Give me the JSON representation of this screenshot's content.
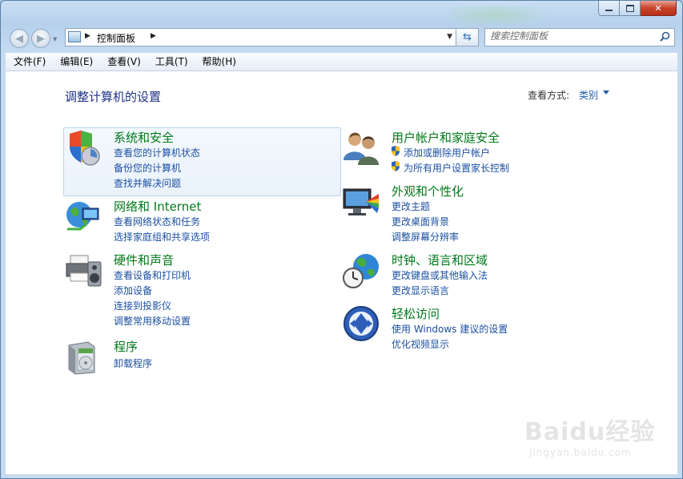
{
  "window": {
    "address": {
      "crumb": "控制面板"
    },
    "search": {
      "placeholder": "搜索控制面板"
    }
  },
  "menu": [
    "文件(F)",
    "编辑(E)",
    "查看(V)",
    "工具(T)",
    "帮助(H)"
  ],
  "page": {
    "title": "调整计算机的设置",
    "view_by_label": "查看方式:",
    "view_by_value": "类别"
  },
  "categories": [
    {
      "title": "系统和安全",
      "links": [
        "查看您的计算机状态",
        "备份您的计算机",
        "查找并解决问题"
      ]
    },
    {
      "title": "网络和 Internet",
      "links": [
        "查看网络状态和任务",
        "选择家庭组和共享选项"
      ]
    },
    {
      "title": "硬件和声音",
      "links": [
        "查看设备和打印机",
        "添加设备",
        "连接到投影仪",
        "调整常用移动设置"
      ]
    },
    {
      "title": "程序",
      "links": [
        "卸载程序"
      ]
    },
    {
      "title": "用户帐户和家庭安全",
      "links": [
        "添加或删除用户帐户",
        "为所有用户设置家长控制"
      ]
    },
    {
      "title": "外观和个性化",
      "links": [
        "更改主题",
        "更改桌面背景",
        "调整屏幕分辨率"
      ]
    },
    {
      "title": "时钟、语言和区域",
      "links": [
        "更改键盘或其他输入法",
        "更改显示语言"
      ]
    },
    {
      "title": "轻松访问",
      "links": [
        "使用 Windows 建议的设置",
        "优化视频显示"
      ]
    }
  ],
  "watermark": {
    "brand": "Baidu经验",
    "url": "jingyan.baidu.com"
  },
  "colors": {
    "category_title": "#00791a",
    "link": "#1a4fa0",
    "page_title": "#1e3287"
  }
}
